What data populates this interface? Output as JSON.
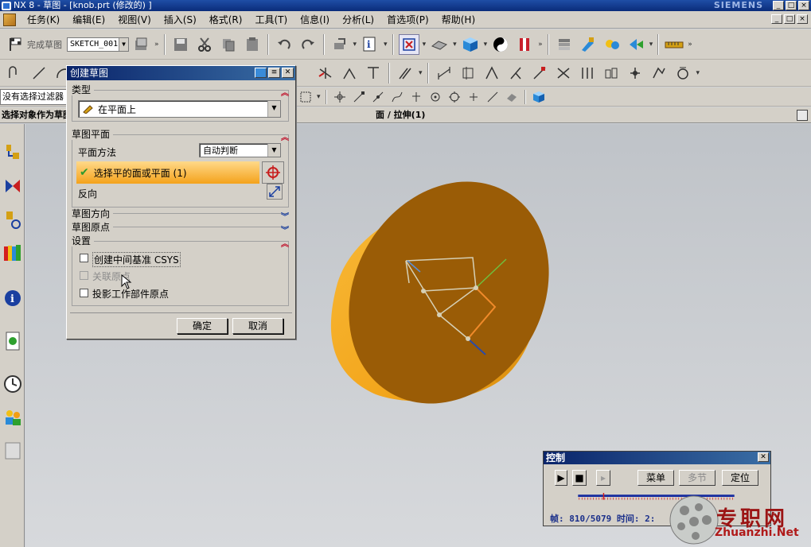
{
  "window": {
    "title": "NX 8 - 草图 - [knob.prt (修改的) ]",
    "brand": "SIEMENS",
    "buttons": [
      "_",
      "□",
      "×"
    ]
  },
  "menubar": {
    "items": [
      "任务(K)",
      "编辑(E)",
      "视图(V)",
      "插入(S)",
      "格式(R)",
      "工具(T)",
      "信息(I)",
      "分析(L)",
      "首选项(P)",
      "帮助(H)"
    ]
  },
  "toolbar": {
    "finish_sketch": "完成草图",
    "sketch_name": "SKETCH_001"
  },
  "filter": {
    "label": "没有选择过滤器"
  },
  "cue": {
    "prompt": "选择对象作为草图平面",
    "status": "面 / 拉伸(1)"
  },
  "dialog": {
    "title": "创建草图",
    "type_group": "类型",
    "type_value": "在平面上",
    "plane_group": "草图平面",
    "plane_method_label": "平面方法",
    "plane_method_value": "自动判断",
    "select_face": "选择平的面或平面 (1)",
    "reverse_label": "反向",
    "orientation_group": "草图方向",
    "origin_group": "草图原点",
    "settings_group": "设置",
    "create_csys": "创建中间基准 CSYS",
    "assoc_origin": "关联原点",
    "project_origin": "投影工作部件原点",
    "ok": "确定",
    "cancel": "取消"
  },
  "control": {
    "title": "控制",
    "menu": "菜单",
    "multi": "多节",
    "locate": "定位",
    "frame_info": "帧: 810/5079 时间: 2:",
    "progress": 0.16
  },
  "watermark": {
    "text": "专职网",
    "url": "Zhuanzhi.Net"
  },
  "colors": {
    "part_orange": "#f3a61c",
    "part_face": "#9a5c06",
    "accent_blue": "#0a246a"
  }
}
